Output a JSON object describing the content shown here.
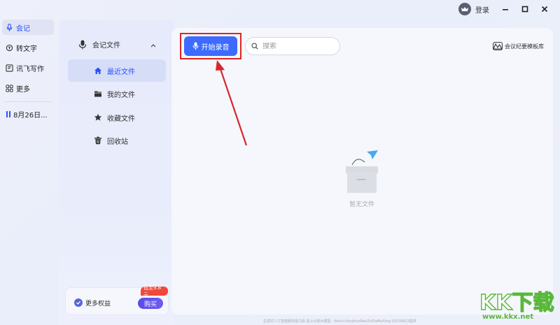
{
  "titlebar": {
    "login_label": "登录"
  },
  "rail": {
    "items": [
      {
        "label": "会记",
        "icon": "microphone-icon"
      },
      {
        "label": "转文字",
        "icon": "convert-icon"
      },
      {
        "label": "讯飞写作",
        "icon": "write-icon"
      },
      {
        "label": "更多",
        "icon": "grid-icon"
      }
    ],
    "recording": {
      "label": "8月26日..."
    }
  },
  "files": {
    "header": "会记文件",
    "folders": [
      {
        "label": "最近文件",
        "icon": "home-icon"
      },
      {
        "label": "我的文件",
        "icon": "folder-icon"
      },
      {
        "label": "收藏文件",
        "icon": "star-icon"
      },
      {
        "label": "回收站",
        "icon": "trash-icon"
      }
    ],
    "promo": {
      "badge": "低至9.8元",
      "text": "更多权益",
      "buy_label": "购买"
    }
  },
  "main": {
    "start_record_label": "开始录音",
    "search_placeholder": "搜索",
    "template_label": "会议纪要模板库",
    "empty_text": "暂无文件",
    "footer": "生成式人工智能服务能力由 星火认知大模型 - Anhui-XingHuoRenZhiDaMoXing-20230822提供"
  },
  "watermark": {
    "big": "KK下载",
    "small": "www.kkx.net"
  },
  "colors": {
    "accent": "#2a53ff",
    "button": "#3d6bff",
    "highlight": "#e02424",
    "badge": "#f0493c"
  }
}
